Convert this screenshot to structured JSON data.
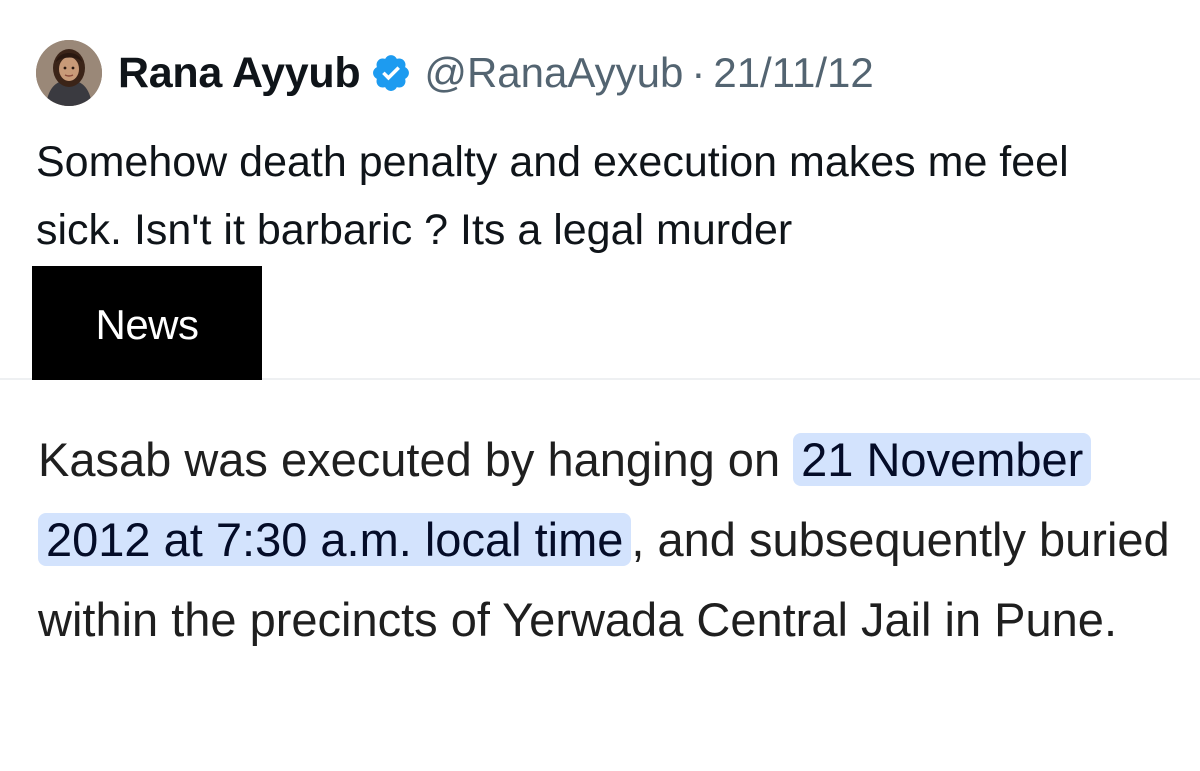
{
  "tweet": {
    "display_name": "Rana Ayyub",
    "handle": "@RanaAyyub",
    "separator": "·",
    "date": "21/11/12",
    "text": "Somehow death penalty and execution makes me feel sick. Isn't it barbaric ? Its a legal murder",
    "avatar_icon": "profile-photo",
    "verified_icon": "verified-badge-icon",
    "verified_color": "#1d9bf0"
  },
  "label": {
    "text": "News"
  },
  "snippet": {
    "text_before": "Kasab was executed by hanging on ",
    "highlight": "21 November 2012 at 7:30 a.m. local time",
    "text_after": ", and subsequently buried within the precincts of Yerwada Central Jail in Pune.",
    "highlight_color": "#d3e3fd"
  }
}
